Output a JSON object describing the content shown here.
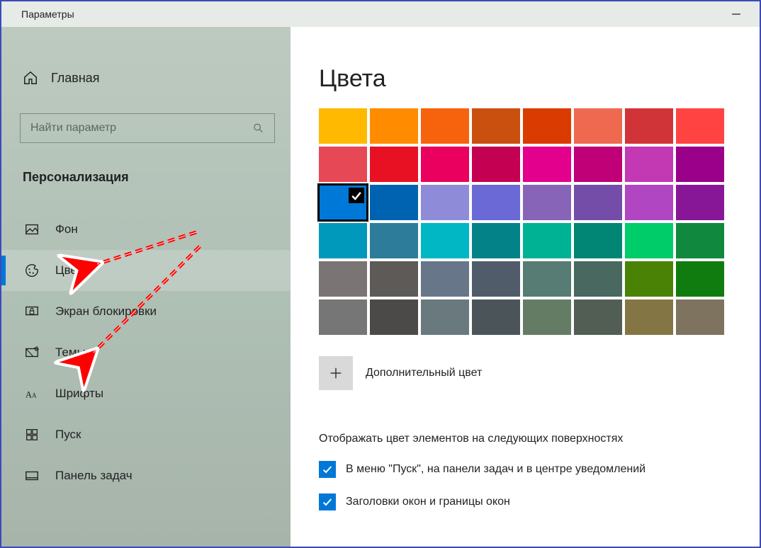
{
  "window": {
    "title": "Параметры"
  },
  "sidebar": {
    "home_label": "Главная",
    "search_placeholder": "Найти параметр",
    "section": "Персонализация",
    "items": [
      {
        "label": "Фон",
        "icon": "picture",
        "active": false
      },
      {
        "label": "Цвета",
        "icon": "palette",
        "active": true
      },
      {
        "label": "Экран блокировки",
        "icon": "lockscreen",
        "active": false
      },
      {
        "label": "Темы",
        "icon": "themes",
        "active": false
      },
      {
        "label": "Шрифты",
        "icon": "fonts",
        "active": false
      },
      {
        "label": "Пуск",
        "icon": "start",
        "active": false
      },
      {
        "label": "Панель задач",
        "icon": "taskbar",
        "active": false
      }
    ]
  },
  "main": {
    "heading": "Цвета",
    "swatches": [
      "#ffb900",
      "#ff8c00",
      "#f7630c",
      "#ca5010",
      "#da3b01",
      "#ef6950",
      "#d13438",
      "#ff4343",
      "#e74856",
      "#e81123",
      "#ea005e",
      "#c30052",
      "#e3008c",
      "#bf0077",
      "#c239b3",
      "#9a0089",
      "#0078d7",
      "#0063b1",
      "#8e8cd8",
      "#6b69d6",
      "#8764b8",
      "#744da9",
      "#b146c2",
      "#881798",
      "#0099bc",
      "#2d7d9a",
      "#00b7c3",
      "#038387",
      "#00b294",
      "#018574",
      "#00cc6a",
      "#10893e",
      "#7a7574",
      "#5d5a58",
      "#68768a",
      "#515c6b",
      "#567c73",
      "#486860",
      "#498205",
      "#107c10",
      "#767676",
      "#4c4a48",
      "#69797e",
      "#4a5459",
      "#647c64",
      "#525e54",
      "#847545",
      "#7e735f"
    ],
    "selected_index": 16,
    "add_color_label": "Дополнительный цвет",
    "surfaces_heading": "Отображать цвет элементов на следующих поверхностях",
    "checkboxes": [
      {
        "label": "В меню \"Пуск\", на панели задач и в центре уведомлений",
        "checked": true
      },
      {
        "label": "Заголовки окон и границы окон",
        "checked": true
      }
    ]
  }
}
